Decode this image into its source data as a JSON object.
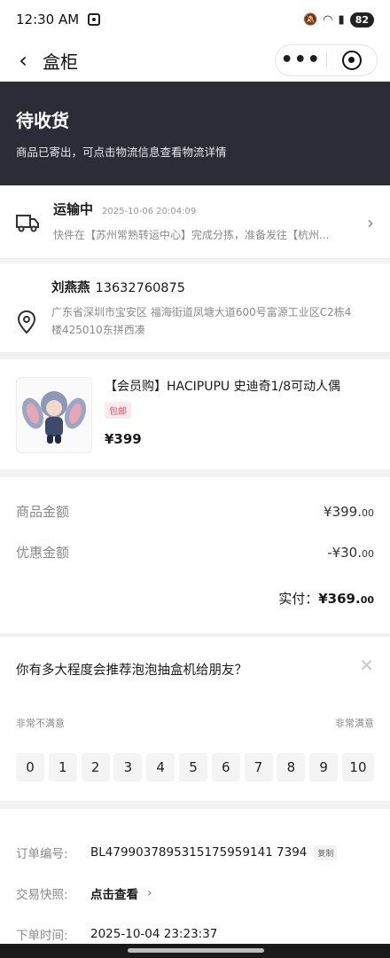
{
  "status_bar": {
    "time": "12:30 AM",
    "battery": "82"
  },
  "navbar": {
    "title": "盒柜"
  },
  "status": {
    "title": "待收货",
    "subtitle": "商品已寄出，可点击物流信息查看物流详情"
  },
  "logistics": {
    "status": "运输中",
    "time": "2025-10-06 20:04:09",
    "desc": "快件在【苏州常熟转运中心】完成分拣，准备发往【杭州..."
  },
  "address": {
    "name": "刘燕燕",
    "phone": "13632760875",
    "detail": "广东省深圳市宝安区 福海街道凤塘大道600号富源工业区C2栋4楼425010东拼西凑"
  },
  "product": {
    "name": "【会员购】HACIPUPU 史迪奇1/8可动人偶",
    "tag": "包邮",
    "price": "¥399"
  },
  "amounts": {
    "goods_label": "商品金额",
    "goods_main": "¥399.",
    "goods_cents": "00",
    "discount_label": "优惠金额",
    "discount_main": "-¥30.",
    "discount_cents": "00",
    "paid_label": "实付：",
    "paid_main": "¥369.",
    "paid_cents": "00"
  },
  "survey": {
    "question": "你有多大程度会推荐泡泡抽盒机给朋友？",
    "low_label": "非常不满意",
    "high_label": "非常满意",
    "scores": [
      "0",
      "1",
      "2",
      "3",
      "4",
      "5",
      "6",
      "7",
      "8",
      "9",
      "10"
    ]
  },
  "order_info": {
    "number_label": "订单编号:",
    "number": "BL4799037895315175959141 7394",
    "copy_label": "复制",
    "snapshot_label": "交易快照:",
    "snapshot_link": "点击查看",
    "time_label": "下单时间:",
    "time": "2025-10-04 23:23:37"
  },
  "colors": {
    "hero_bg": "#2c2c36",
    "tag_red": "#e84b5d"
  }
}
